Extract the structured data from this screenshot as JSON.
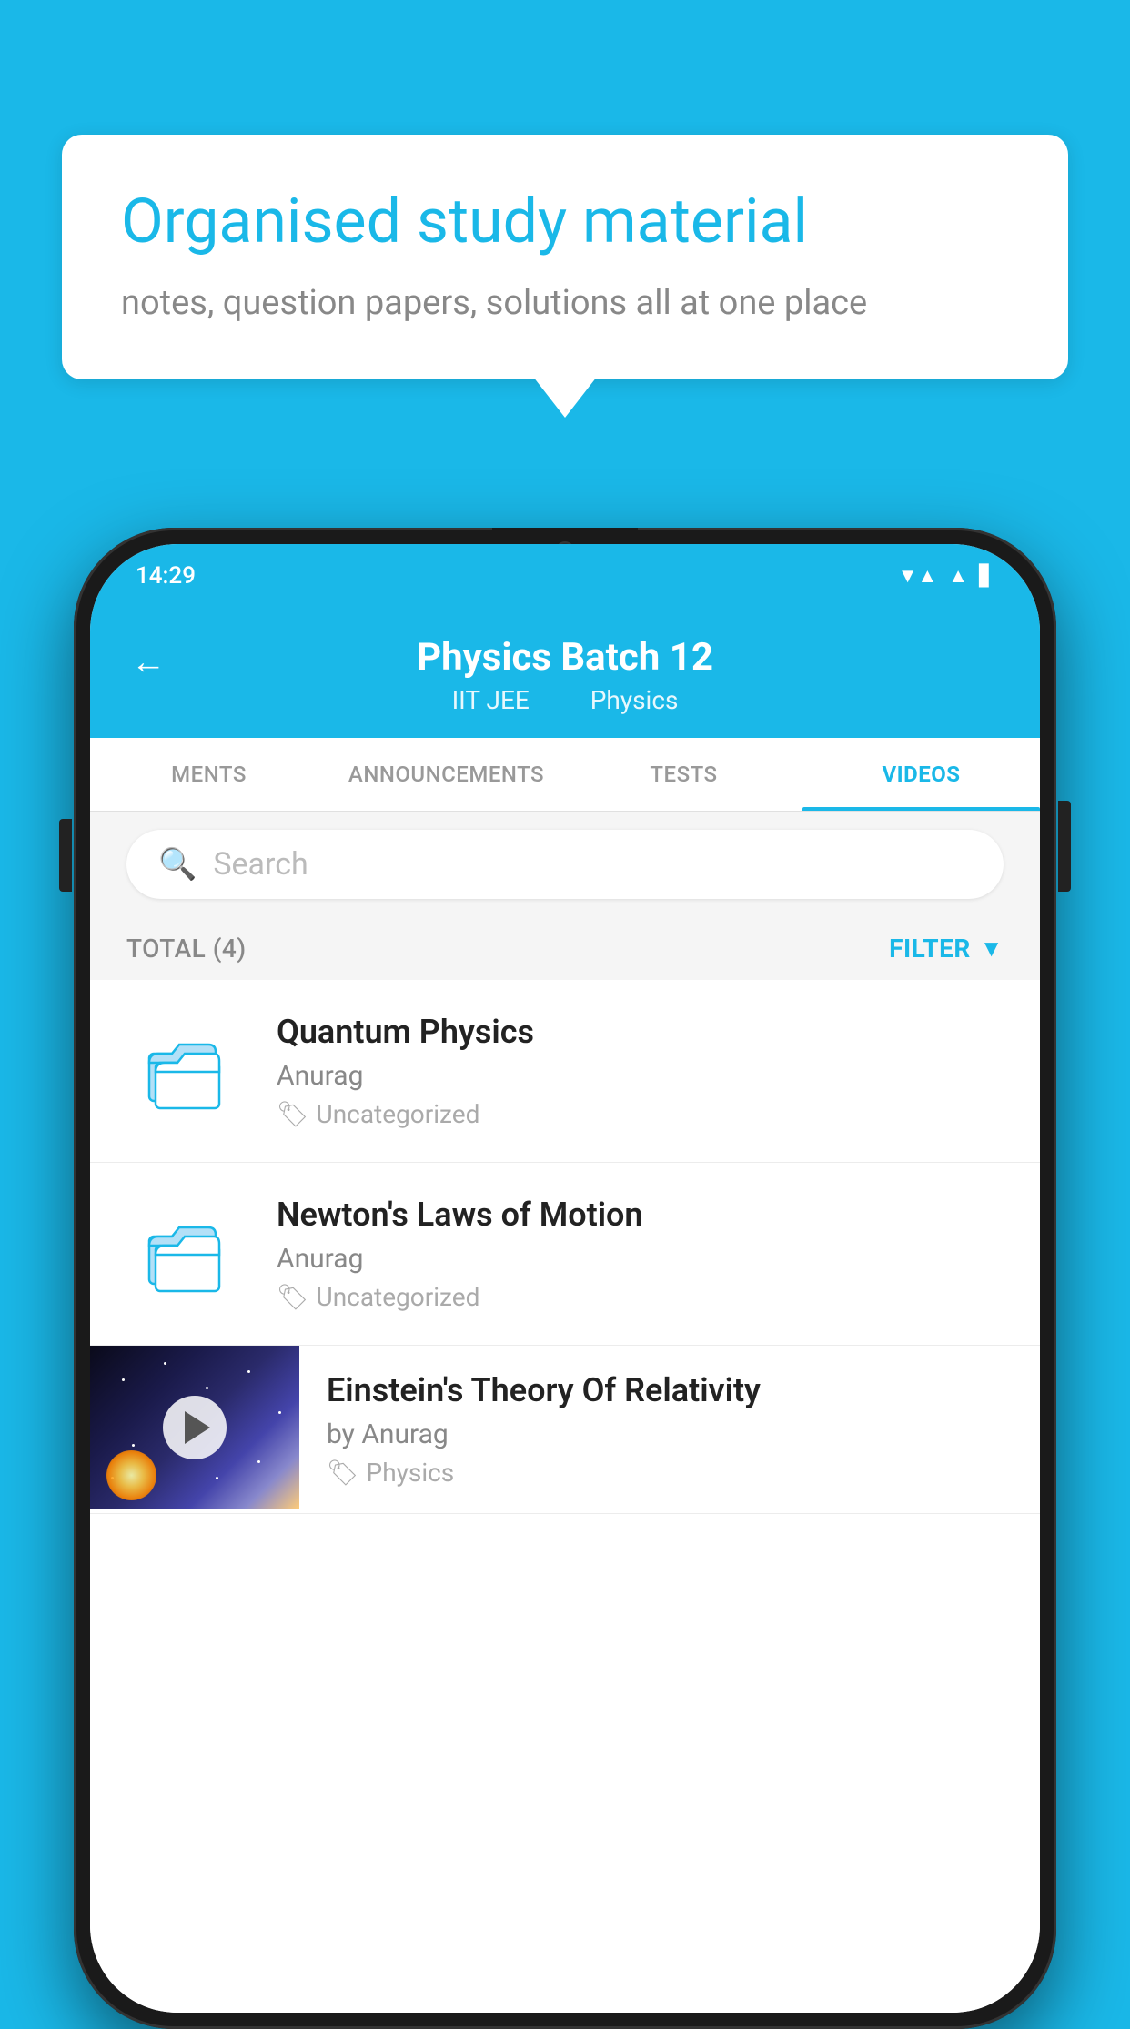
{
  "background": {
    "color": "#1ab8e8"
  },
  "speech_bubble": {
    "heading": "Organised study material",
    "subtext": "notes, question papers, solutions all at one place"
  },
  "phone": {
    "status_bar": {
      "time": "14:29",
      "icons": [
        "wifi",
        "signal",
        "battery"
      ]
    },
    "app_header": {
      "back_label": "←",
      "title": "Physics Batch 12",
      "subtitle_part1": "IIT JEE",
      "subtitle_part2": "Physics"
    },
    "tabs": [
      {
        "label": "MENTS",
        "active": false
      },
      {
        "label": "ANNOUNCEMENTS",
        "active": false
      },
      {
        "label": "TESTS",
        "active": false
      },
      {
        "label": "VIDEOS",
        "active": true
      }
    ],
    "search": {
      "placeholder": "Search"
    },
    "filter_bar": {
      "total_label": "TOTAL (4)",
      "filter_label": "FILTER"
    },
    "video_items": [
      {
        "id": 1,
        "type": "folder",
        "title": "Quantum Physics",
        "author": "Anurag",
        "tag": "Uncategorized"
      },
      {
        "id": 2,
        "type": "folder",
        "title": "Newton's Laws of Motion",
        "author": "Anurag",
        "tag": "Uncategorized"
      },
      {
        "id": 3,
        "type": "thumbnail",
        "title": "Einstein's Theory Of Relativity",
        "author": "by Anurag",
        "tag": "Physics"
      }
    ]
  }
}
